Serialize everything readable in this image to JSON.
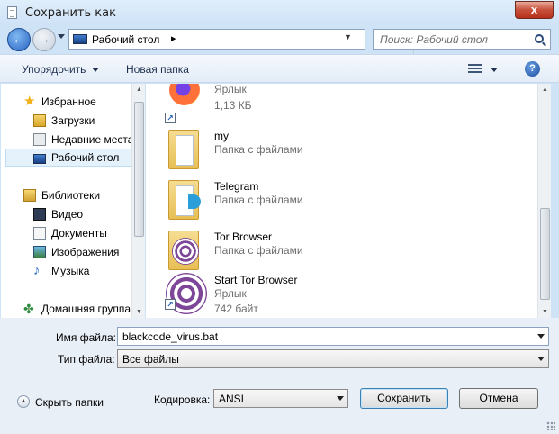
{
  "window": {
    "title": "Сохранить как",
    "close_glyph": "x"
  },
  "address": {
    "location": "Рабочий стол",
    "separator": "▸",
    "search_placeholder": "Поиск: Рабочий стол"
  },
  "toolbar": {
    "organize": "Упорядочить",
    "new_folder": "Новая папка",
    "help": "?"
  },
  "sidebar": {
    "items": [
      {
        "label": "Избранное",
        "icon": "star-icon"
      },
      {
        "label": "Загрузки",
        "icon": "downloads-icon"
      },
      {
        "label": "Недавние места",
        "icon": "recent-places-icon"
      },
      {
        "label": "Рабочий стол",
        "icon": "desktop-icon",
        "selected": true
      },
      {
        "label": "Библиотеки",
        "icon": "libraries-icon"
      },
      {
        "label": "Видео",
        "icon": "video-icon"
      },
      {
        "label": "Документы",
        "icon": "documents-icon"
      },
      {
        "label": "Изображения",
        "icon": "images-icon"
      },
      {
        "label": "Музыка",
        "icon": "music-icon"
      },
      {
        "label": "Домашняя группа",
        "icon": "homegroup-icon"
      }
    ]
  },
  "files": [
    {
      "name": "",
      "line2": "Ярлык",
      "line3": "1,13 КБ",
      "icon": "firefox-shortcut-icon"
    },
    {
      "name": "my",
      "line2": "Папка с файлами",
      "icon": "folder-icon"
    },
    {
      "name": "Telegram",
      "line2": "Папка с файлами",
      "icon": "folder-icon"
    },
    {
      "name": "Tor Browser",
      "line2": "Папка с файлами",
      "icon": "folder-icon"
    },
    {
      "name": "Start Tor Browser",
      "line2": "Ярлык",
      "line3": "742 байт",
      "icon": "tor-shortcut-icon"
    }
  ],
  "form": {
    "filename_label": "Имя файла:",
    "filename_value": "blackcode_virus.bat",
    "filetype_label": "Тип файла:",
    "filetype_value": "Все файлы",
    "encoding_label": "Кодировка:",
    "encoding_value": "ANSI",
    "hide_folders": "Скрыть папки",
    "save": "Сохранить",
    "cancel": "Отмена"
  }
}
